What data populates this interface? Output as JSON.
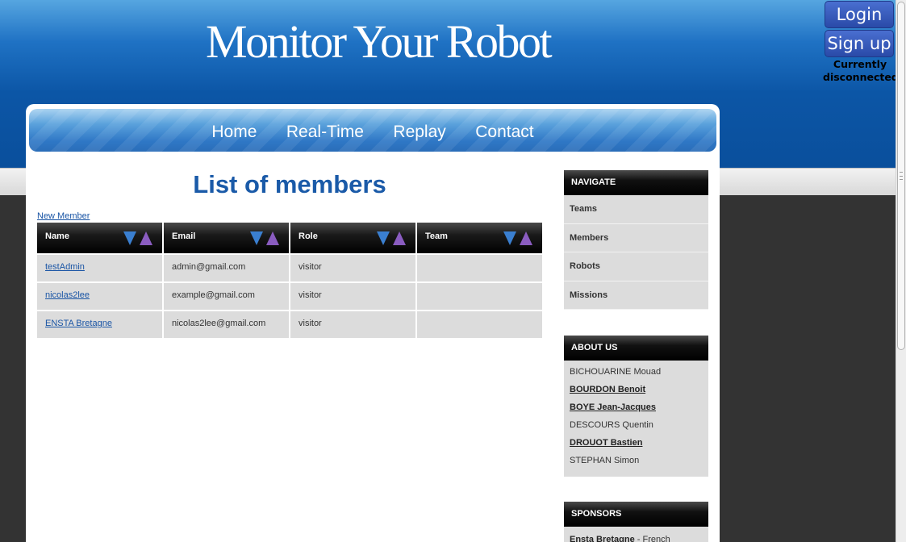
{
  "site": {
    "title": "Monitor Your Robot"
  },
  "auth": {
    "login_label": "Login",
    "signup_label": "Sign up",
    "status": "Currently disconnected"
  },
  "nav": {
    "items": [
      {
        "label": "Home"
      },
      {
        "label": "Real-Time"
      },
      {
        "label": "Replay"
      },
      {
        "label": "Contact"
      }
    ]
  },
  "main": {
    "heading": "List of members",
    "new_member_link": "New Member",
    "columns": [
      "Name",
      "Email",
      "Role",
      "Team"
    ],
    "rows": [
      {
        "name": "testAdmin",
        "email": "admin@gmail.com",
        "role": "visitor",
        "team": ""
      },
      {
        "name": "nicolas2lee",
        "email": "example@gmail.com",
        "role": "visitor",
        "team": ""
      },
      {
        "name": "ENSTA Bretagne",
        "email": "nicolas2lee@gmail.com",
        "role": "visitor",
        "team": ""
      }
    ],
    "sort_colors": {
      "down": "#3a7fd0",
      "up": "#8a5cc0"
    }
  },
  "sidebar": {
    "navigate": {
      "title": "NAVIGATE",
      "items": [
        {
          "label": "Teams"
        },
        {
          "label": "Members"
        },
        {
          "label": "Robots"
        },
        {
          "label": "Missions"
        }
      ]
    },
    "about": {
      "title": "ABOUT US",
      "people": [
        {
          "name": "BICHOUARINE Mouad",
          "linked": false
        },
        {
          "name": "BOURDON Benoit",
          "linked": true
        },
        {
          "name": "BOYE Jean-Jacques",
          "linked": true
        },
        {
          "name": "DESCOURS Quentin",
          "linked": false
        },
        {
          "name": "DROUOT Bastien",
          "linked": true
        },
        {
          "name": "STEPHAN Simon",
          "linked": false
        }
      ]
    },
    "sponsors": {
      "title": "SPONSORS",
      "first_name": "Ensta Bretagne",
      "first_desc": " - French"
    }
  }
}
